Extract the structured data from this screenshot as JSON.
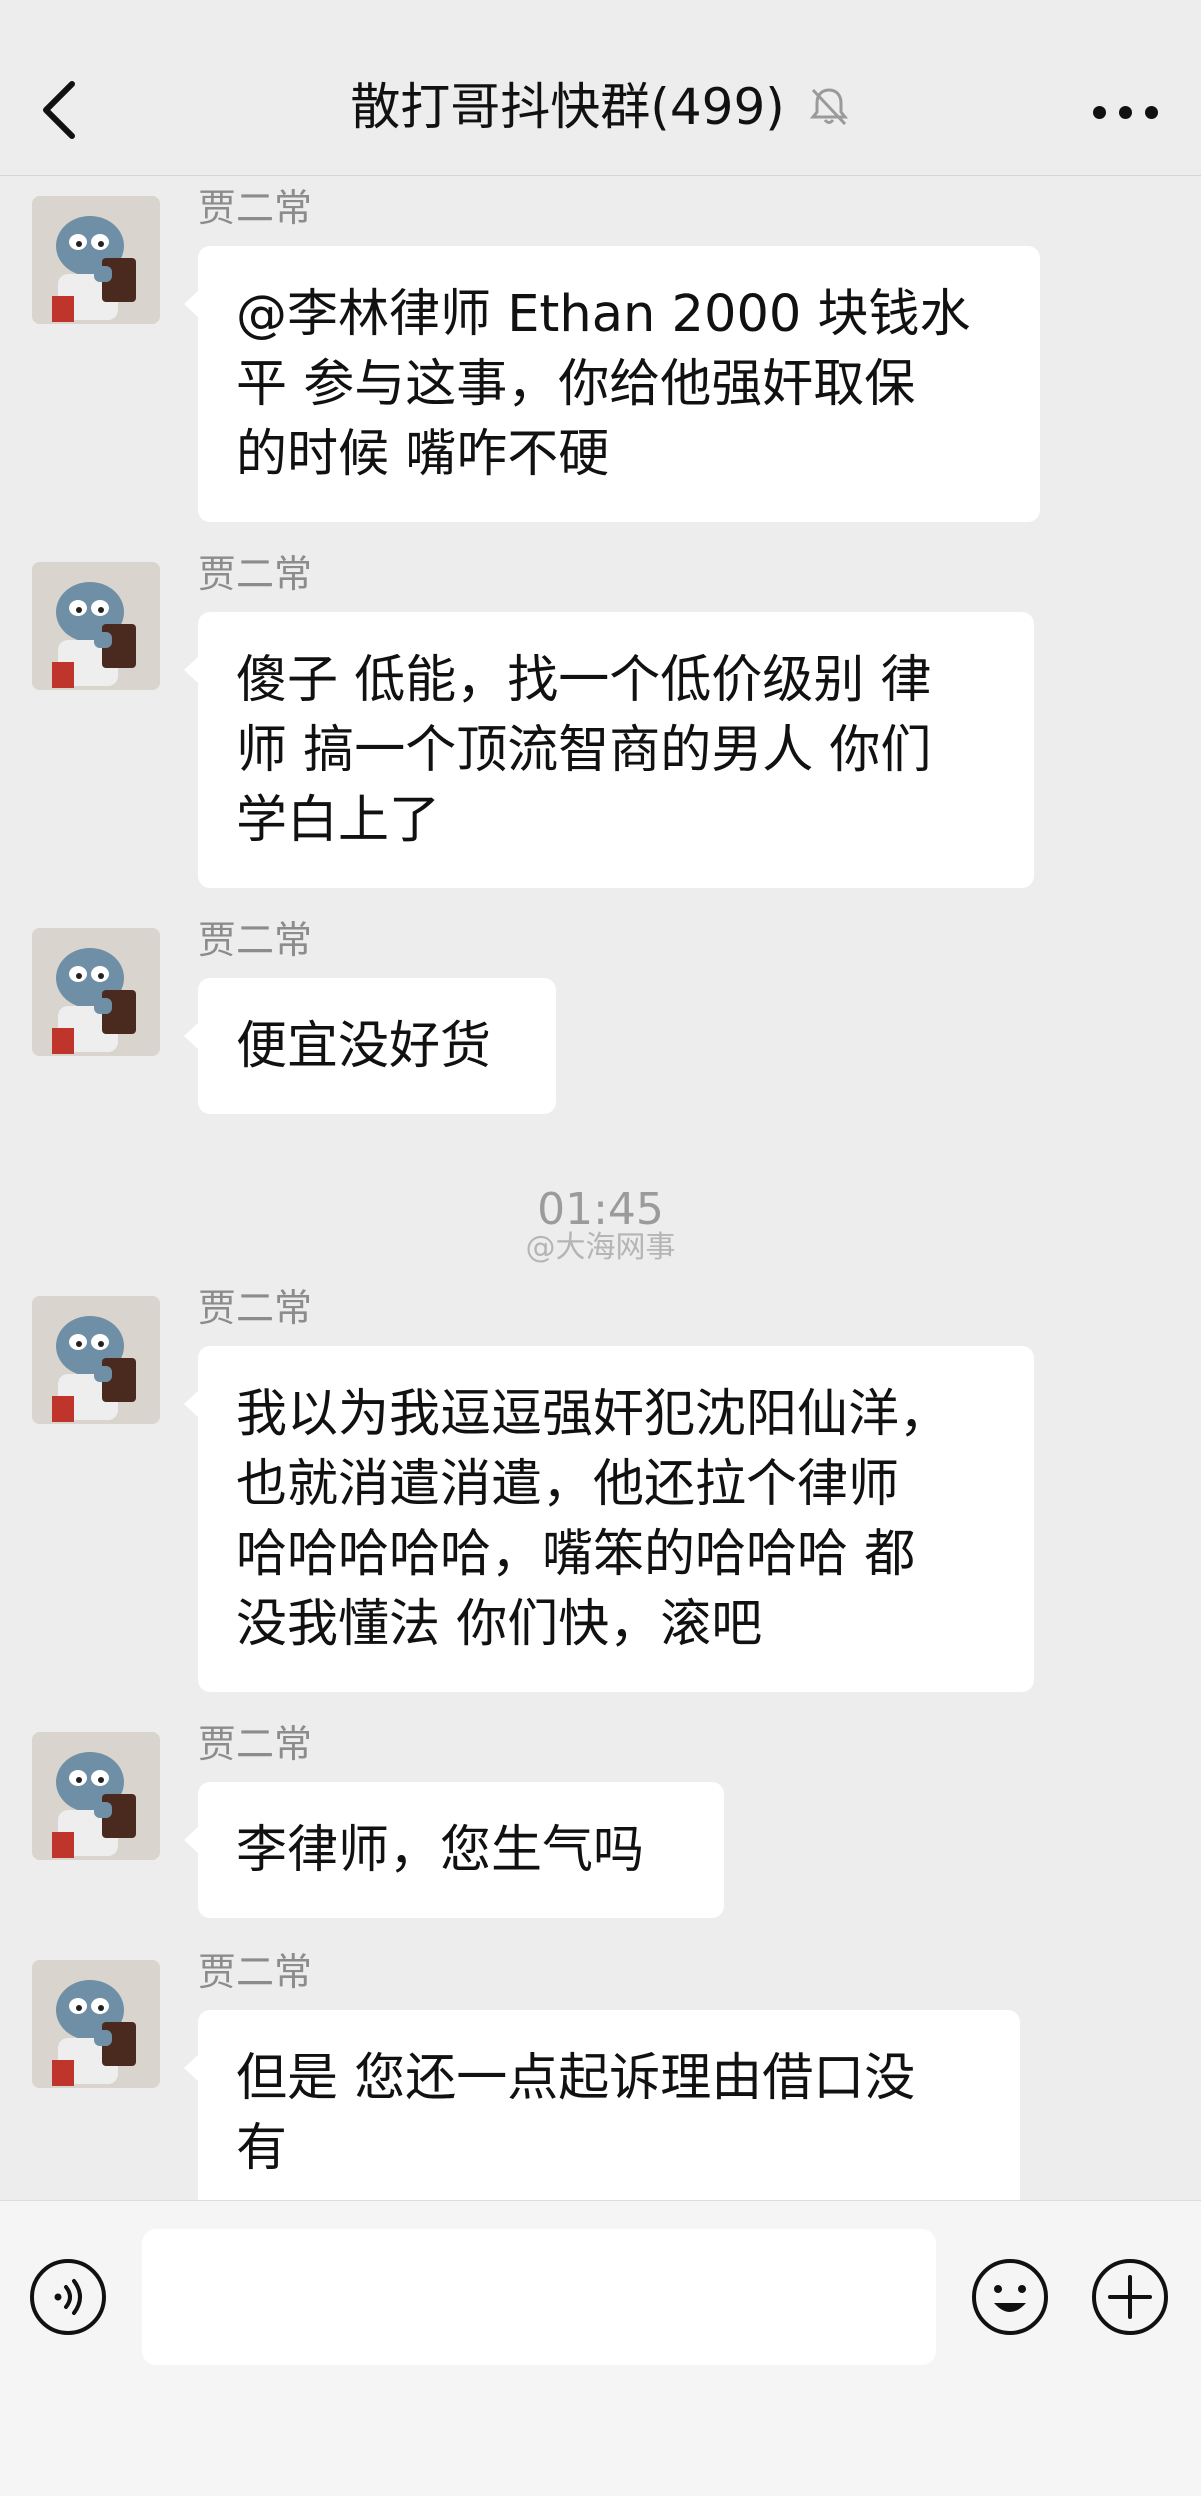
{
  "header": {
    "title": "散打哥抖快群(499)",
    "back_icon": "chevron-left-icon",
    "mute_icon": "bell-off-icon",
    "more_icon": "ellipsis-icon"
  },
  "messages": [
    {
      "sender": "贾二常",
      "text": "@李林律师 Ethan 2000 块钱水\n平 参与这事，你给他强奸取保\n的时候 嘴咋不硬"
    },
    {
      "sender": "贾二常",
      "text": "傻子 低能，找一个低价级别 律\n师 搞一个顶流智商的男人 你们\n学白上了"
    },
    {
      "sender": "贾二常",
      "text": "便宜没好货"
    },
    {
      "sender": "贾二常",
      "text": "我以为我逗逗强奸犯沈阳仙洋，\n也就消遣消遣，他还拉个律师\n哈哈哈哈哈，嘴笨的哈哈哈 都\n没我懂法 你们快，滚吧"
    },
    {
      "sender": "贾二常",
      "text": "李律师，您生气吗"
    },
    {
      "sender": "贾二常",
      "text": "但是 您还一点起诉理由借口没\n有"
    }
  ],
  "timestamp": "01:45",
  "watermark": "@大海网事",
  "input_bar": {
    "voice_icon": "voice-icon",
    "emoji_icon": "emoji-icon",
    "plus_icon": "plus-icon",
    "input_value": ""
  }
}
